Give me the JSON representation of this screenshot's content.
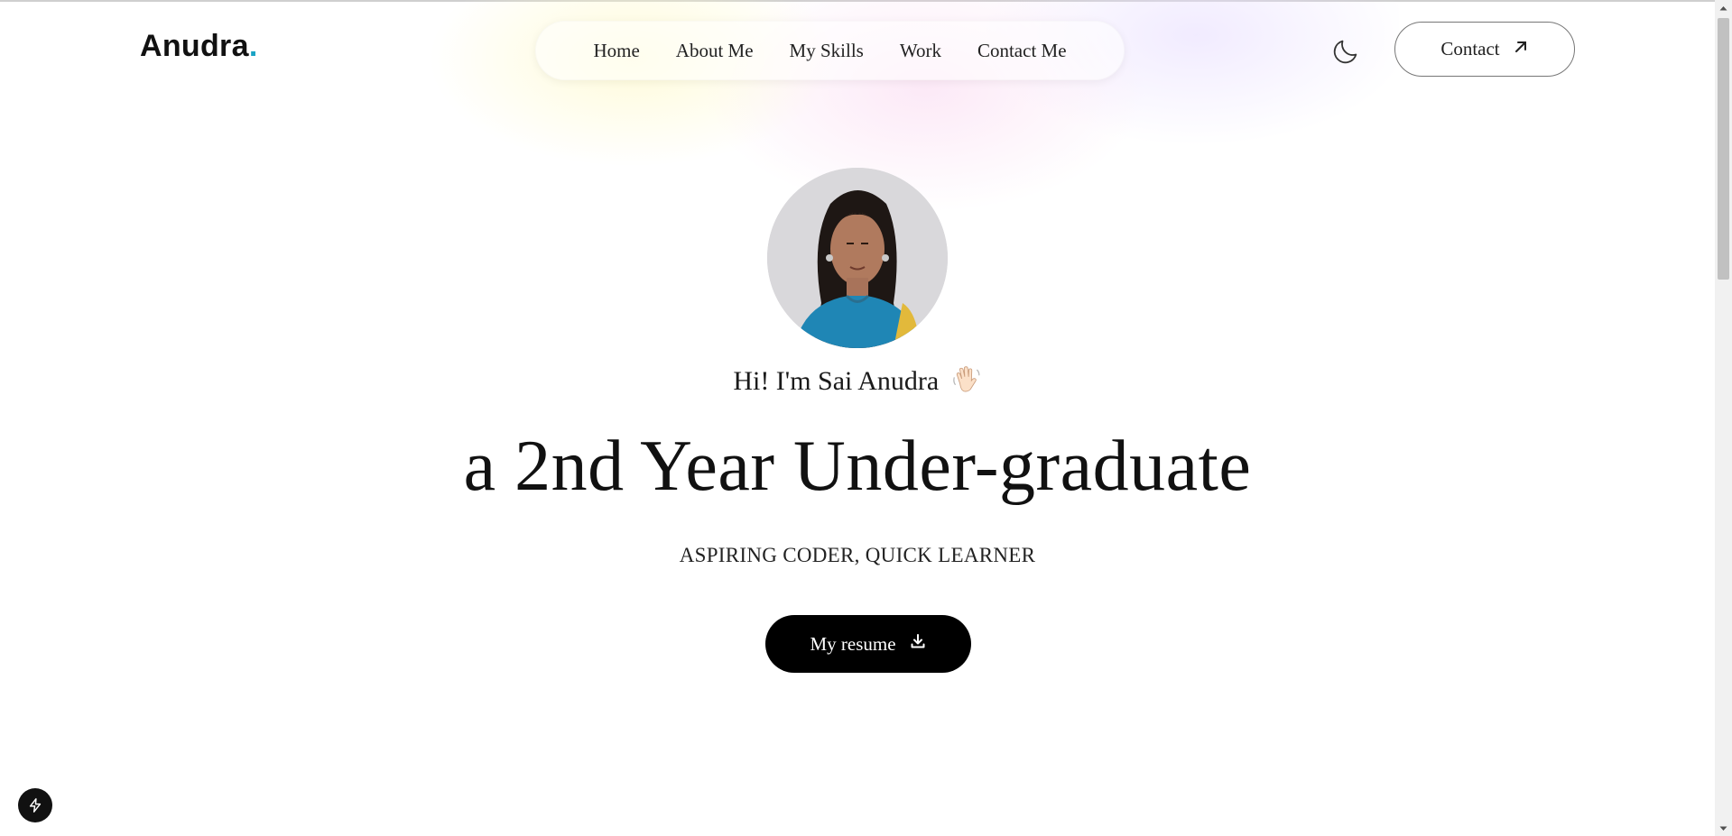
{
  "brand": {
    "name": "Anudra",
    "dot": "."
  },
  "nav": {
    "items": [
      {
        "label": "Home"
      },
      {
        "label": "About Me"
      },
      {
        "label": "My Skills"
      },
      {
        "label": "Work"
      },
      {
        "label": "Contact Me"
      }
    ]
  },
  "header": {
    "theme_toggle_icon": "moon-icon",
    "contact_button": {
      "label": "Contact",
      "icon": "arrow-up-right-icon"
    }
  },
  "hero": {
    "greeting": "Hi! I'm Sai Anudra",
    "greeting_emoji": "waving-hand-icon",
    "headline": "a 2nd Year Under-graduate",
    "tagline": "ASPIRING CODER, QUICK LEARNER",
    "resume_button": {
      "label": "My resume",
      "icon": "download-icon"
    }
  },
  "colors": {
    "accent_dot": "#1aa3c4",
    "primary_button_bg": "#000000",
    "text": "#111111"
  },
  "floating_button_icon": "lightning-icon"
}
